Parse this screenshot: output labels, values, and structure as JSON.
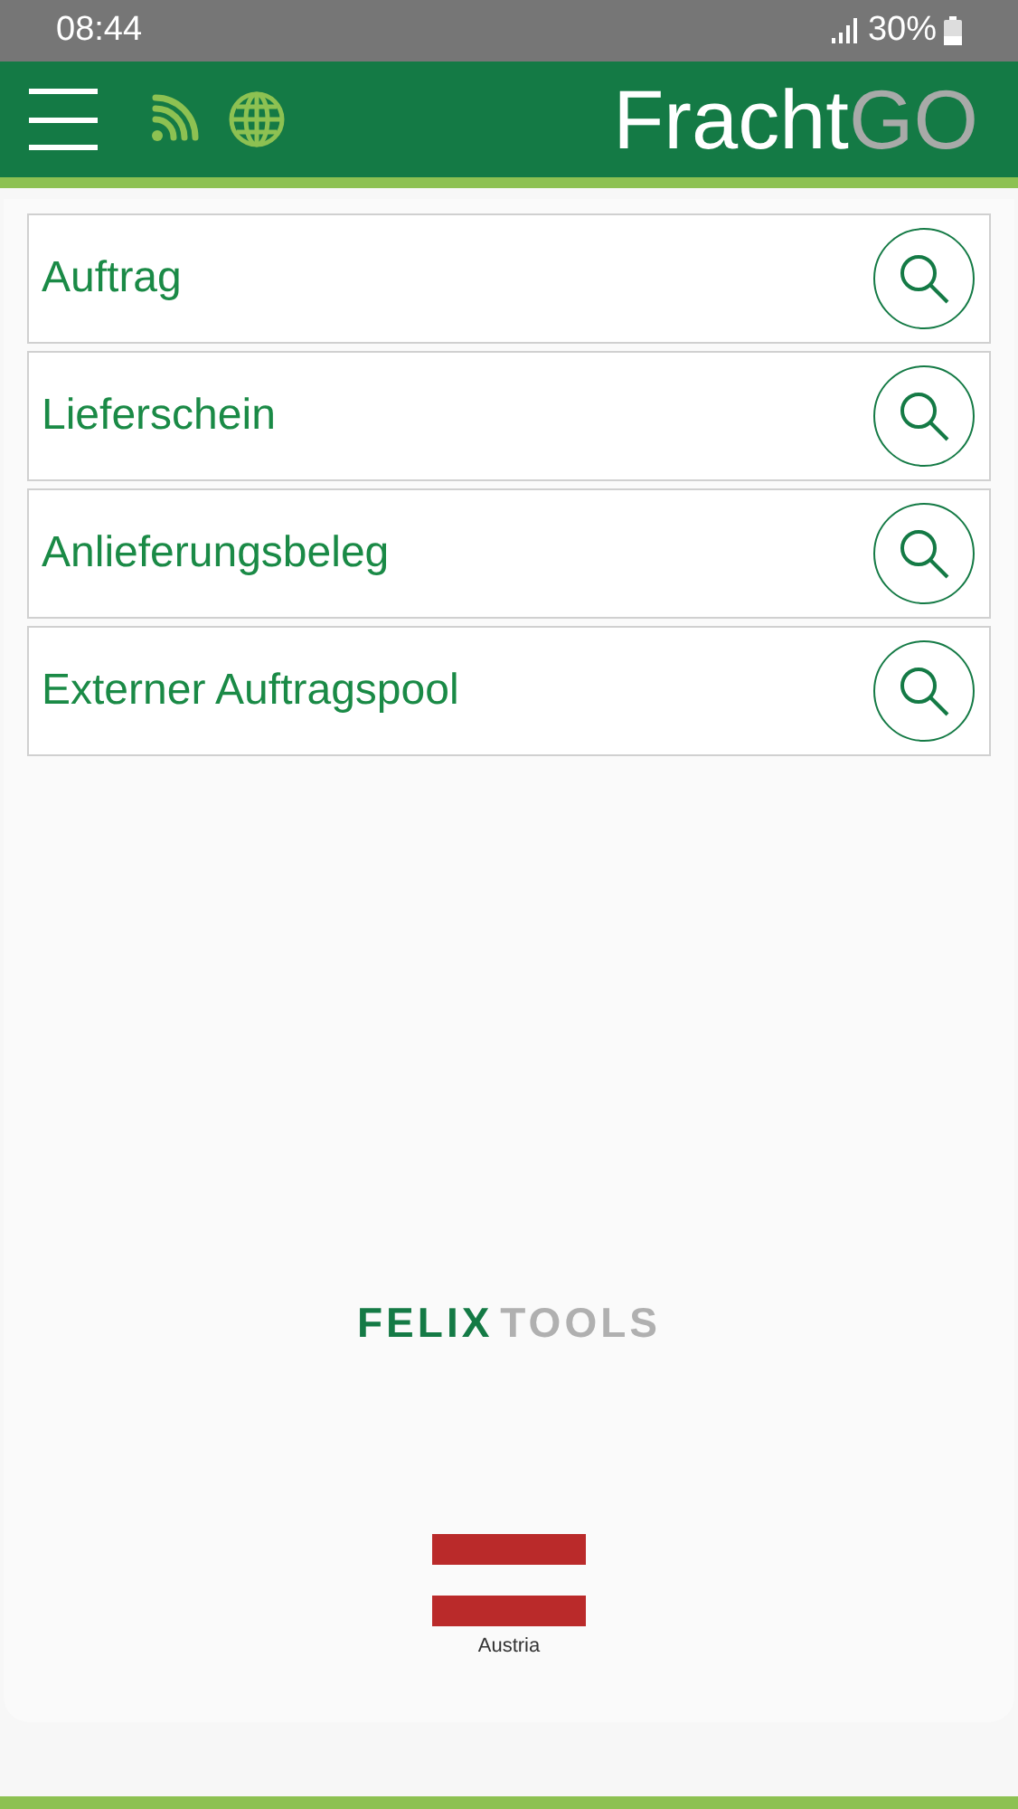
{
  "status_bar": {
    "time": "08:44",
    "battery": "30%"
  },
  "header": {
    "title": "Fracht",
    "title_accent": "GO"
  },
  "menu": [
    {
      "label": "Auftrag"
    },
    {
      "label": "Lieferschein"
    },
    {
      "label": "Anlieferungsbeleg"
    },
    {
      "label": "Externer Auftragspool"
    }
  ],
  "logo": {
    "part1": "FELIX",
    "part2": "TOOLS"
  },
  "country": {
    "label": "Austria"
  }
}
